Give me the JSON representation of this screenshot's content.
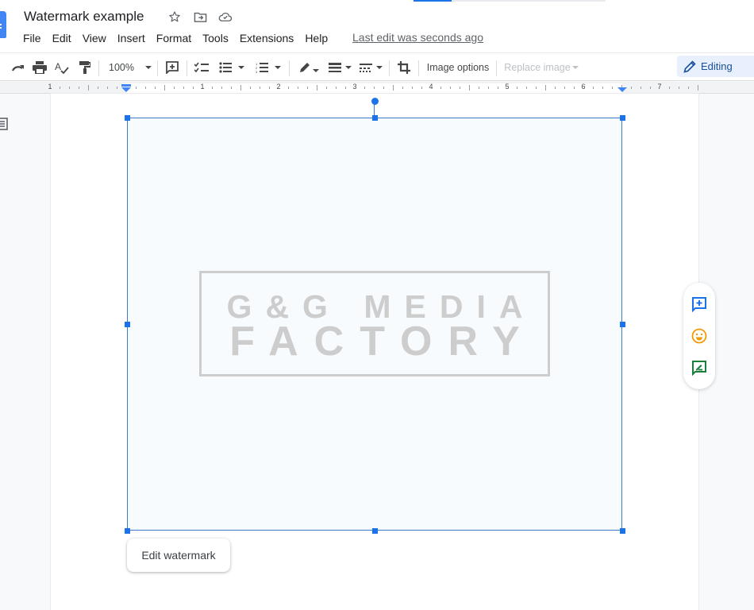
{
  "app": {
    "doc_title": "Watermark example",
    "last_edit": "Last edit was seconds ago",
    "save_progress": 0.2
  },
  "title_icons": [
    "star-icon",
    "move-to-folder-icon",
    "cloud-saved-icon"
  ],
  "menu": [
    "File",
    "Edit",
    "View",
    "Insert",
    "Format",
    "Tools",
    "Extensions",
    "Help"
  ],
  "toolbar": {
    "zoom": "100%",
    "image_options": "Image options",
    "replace_image": "Replace image",
    "mode": "Editing"
  },
  "ruler": {
    "labels": [
      "1",
      "1",
      "2",
      "3",
      "4",
      "5",
      "6",
      "7"
    ]
  },
  "watermark": {
    "line1": "G&G MEDIA",
    "line2": "FACTORY"
  },
  "edit_watermark": "Edit watermark",
  "side_actions": [
    "add-comment-icon",
    "add-emoji-reaction-icon",
    "suggest-edits-icon"
  ],
  "colors": {
    "accent": "#1a73e8",
    "watermark_gray": "#cdcdcd",
    "editing_bg": "#e8f0fe"
  }
}
